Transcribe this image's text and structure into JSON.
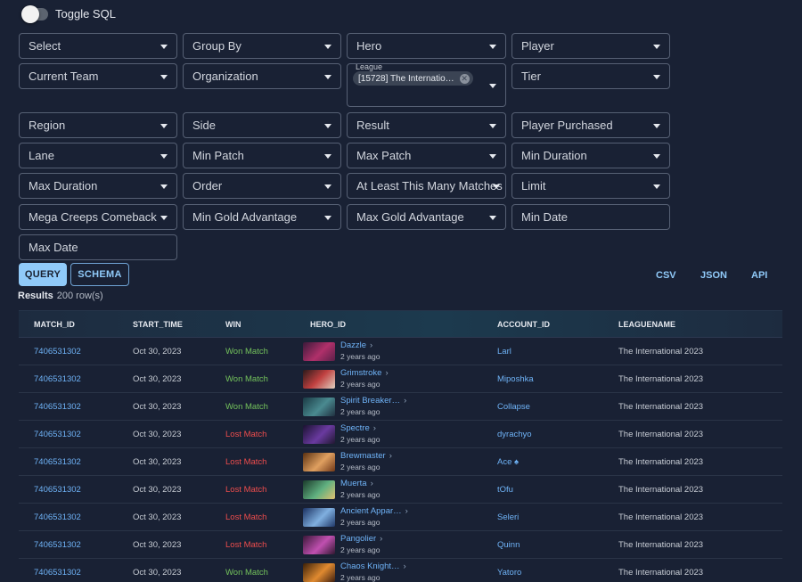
{
  "toggle": {
    "label": "Toggle SQL"
  },
  "filters": {
    "select": "Select",
    "group_by": "Group By",
    "hero": "Hero",
    "player": "Player",
    "current_team": "Current Team",
    "organization": "Organization",
    "league_label": "League",
    "league_chip": "[15728] The Internatio…",
    "tier": "Tier",
    "region": "Region",
    "side": "Side",
    "result": "Result",
    "player_purchased": "Player Purchased",
    "lane": "Lane",
    "min_patch": "Min Patch",
    "max_patch": "Max Patch",
    "min_duration": "Min Duration",
    "max_duration": "Max Duration",
    "order": "Order",
    "at_least_matches": "At Least This Many Matches",
    "limit": "Limit",
    "mega_creeps": "Mega Creeps Comeback",
    "min_gold": "Min Gold Advantage",
    "max_gold": "Max Gold Advantage",
    "min_date": "Min Date",
    "max_date": "Max Date"
  },
  "actions": {
    "query": "QUERY",
    "schema": "SCHEMA",
    "csv": "CSV",
    "json": "JSON",
    "api": "API"
  },
  "results": {
    "title": "Results",
    "count": "200 row(s)"
  },
  "table": {
    "headers": {
      "match_id": "MATCH_ID",
      "start_time": "START_TIME",
      "win": "WIN",
      "hero_id": "HERO_ID",
      "account_id": "ACCOUNT_ID",
      "leaguename": "LEAGUENAME"
    },
    "rows": [
      {
        "match_id": "7406531302",
        "start_time": "Oct 30, 2023",
        "win": "Won Match",
        "hero": "Dazzle",
        "age": "2 years ago",
        "account": "Larl",
        "league": "The International 2023"
      },
      {
        "match_id": "7406531302",
        "start_time": "Oct 30, 2023",
        "win": "Won Match",
        "hero": "Grimstroke",
        "age": "2 years ago",
        "account": "Miposhka",
        "league": "The International 2023"
      },
      {
        "match_id": "7406531302",
        "start_time": "Oct 30, 2023",
        "win": "Won Match",
        "hero": "Spirit Breaker…",
        "age": "2 years ago",
        "account": "Collapse",
        "league": "The International 2023"
      },
      {
        "match_id": "7406531302",
        "start_time": "Oct 30, 2023",
        "win": "Lost Match",
        "hero": "Spectre",
        "age": "2 years ago",
        "account": "dyrachyo",
        "league": "The International 2023"
      },
      {
        "match_id": "7406531302",
        "start_time": "Oct 30, 2023",
        "win": "Lost Match",
        "hero": "Brewmaster",
        "age": "2 years ago",
        "account": "Ace ♠",
        "league": "The International 2023"
      },
      {
        "match_id": "7406531302",
        "start_time": "Oct 30, 2023",
        "win": "Lost Match",
        "hero": "Muerta",
        "age": "2 years ago",
        "account": "tOfu",
        "league": "The International 2023"
      },
      {
        "match_id": "7406531302",
        "start_time": "Oct 30, 2023",
        "win": "Lost Match",
        "hero": "Ancient Appar…",
        "age": "2 years ago",
        "account": "Seleri",
        "league": "The International 2023"
      },
      {
        "match_id": "7406531302",
        "start_time": "Oct 30, 2023",
        "win": "Lost Match",
        "hero": "Pangolier",
        "age": "2 years ago",
        "account": "Quinn",
        "league": "The International 2023"
      },
      {
        "match_id": "7406531302",
        "start_time": "Oct 30, 2023",
        "win": "Won Match",
        "hero": "Chaos Knight…",
        "age": "2 years ago",
        "account": "Yatoro",
        "league": "The International 2023"
      }
    ]
  },
  "colors": {
    "won": "#74c35c",
    "lost": "#ee4d4d",
    "link": "#6fb3f7",
    "accent": "#90caf9"
  }
}
